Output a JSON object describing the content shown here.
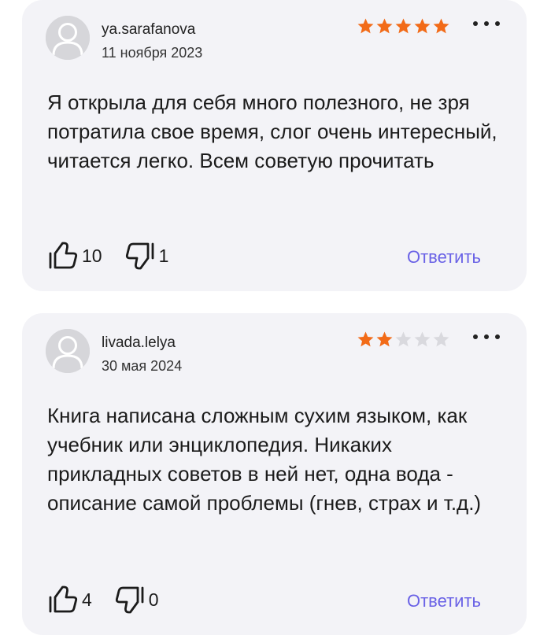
{
  "colors": {
    "card_background": "#f3f3f7",
    "star_filled": "#f26b18",
    "star_empty": "#d9d9de",
    "accent": "#6a62e6",
    "avatar": "#d6d6da"
  },
  "reviews": [
    {
      "username": "ya.sarafanova",
      "date": "11 ноября 2023",
      "rating": 5,
      "text": "Я открыла для себя много полезного, не зря потратила свое время, слог очень интересный, читается легко. Всем советую прочитать",
      "likes": "10",
      "dislikes": "1",
      "reply_label": "Ответить",
      "avatar_icon": "user-avatar-icon",
      "menu_icon": "more-dots-icon"
    },
    {
      "username": "livada.lelya",
      "date": "30 мая 2024",
      "rating": 2,
      "text": "Книга написана сложным сухим языком, как учебник или энциклопедия. Никаких прикладных советов в ней нет, одна вода - описание самой проблемы (гнев, страх и т.д.)",
      "likes": "4",
      "dislikes": "0",
      "reply_label": "Ответить",
      "avatar_icon": "user-avatar-icon",
      "menu_icon": "more-dots-icon"
    }
  ]
}
